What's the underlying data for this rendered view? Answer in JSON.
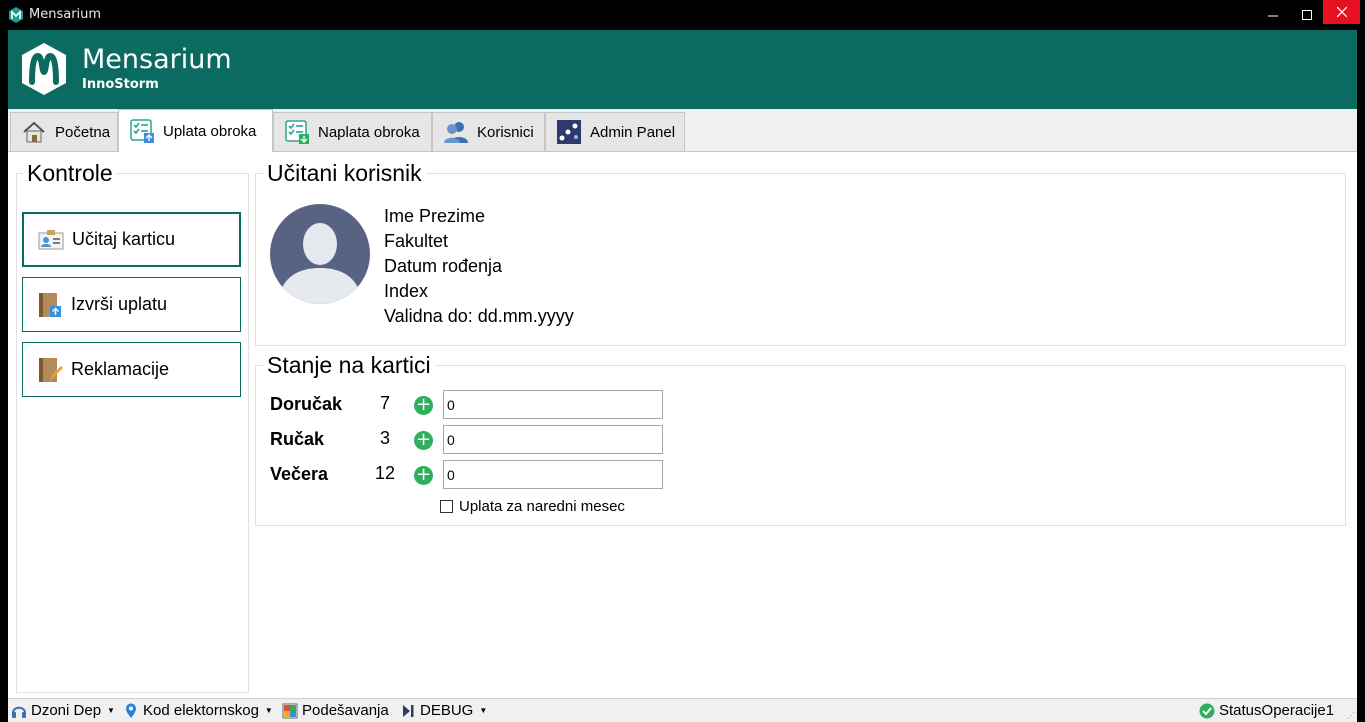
{
  "window": {
    "title": "Mensarium"
  },
  "header": {
    "brand": "Mensarium",
    "subtitle": "InnoStorm"
  },
  "tabs": [
    {
      "label": "Početna",
      "icon": "home-icon"
    },
    {
      "label": "Uplata obroka",
      "icon": "checklist-upload-icon",
      "active": true
    },
    {
      "label": "Naplata obroka",
      "icon": "checklist-download-icon"
    },
    {
      "label": "Korisnici",
      "icon": "users-icon"
    },
    {
      "label": "Admin Panel",
      "icon": "admin-panel-icon"
    }
  ],
  "controls": {
    "title": "Kontrole",
    "buttons": [
      {
        "label": "Učitaj karticu",
        "icon": "id-card-icon"
      },
      {
        "label": "Izvrši uplatu",
        "icon": "book-upload-icon"
      },
      {
        "label": "Reklamacije",
        "icon": "book-edit-icon"
      }
    ]
  },
  "user": {
    "title": "Učitani korisnik",
    "name": "Ime Prezime",
    "faculty": "Fakultet",
    "birth": "Datum rođenja",
    "index": "Index",
    "valid": "Validna do: dd.mm.yyyy"
  },
  "balance": {
    "title": "Stanje na kartici",
    "meals": [
      {
        "label": "Doručak",
        "count": "7",
        "value": "0"
      },
      {
        "label": "Ručak",
        "count": "3",
        "value": "0"
      },
      {
        "label": "Večera",
        "count": "12",
        "value": "0"
      }
    ],
    "next_month_label": "Uplata za naredni mesec"
  },
  "statusbar": {
    "user": "Dzoni Dep",
    "location": "Kod elektornskog",
    "settings": "Podešavanja",
    "debug": "DEBUG",
    "status": "StatusOperacije1"
  },
  "colors": {
    "accent": "#0b6b61",
    "plus": "#2fae5d",
    "close": "#e81123"
  }
}
